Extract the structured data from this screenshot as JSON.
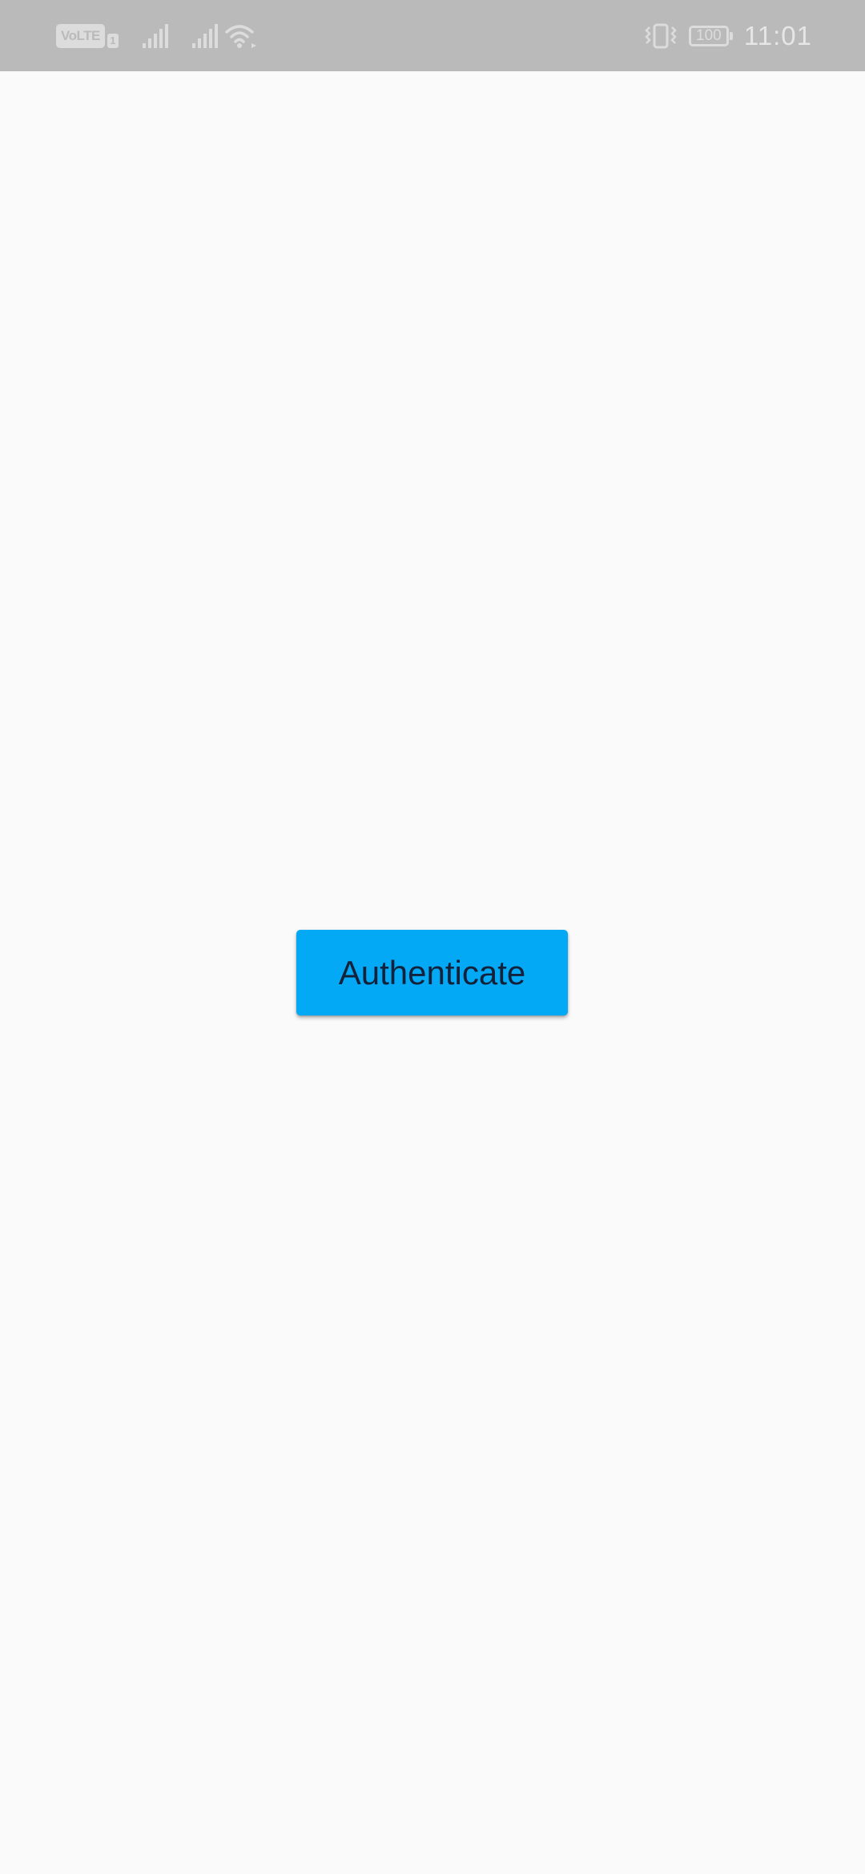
{
  "status_bar": {
    "network_badge": "VoLTE",
    "sim_slot": "1",
    "battery_level": "100",
    "time": "11:01",
    "icons": [
      "volte-icon",
      "signal-icon",
      "signal-icon",
      "wifi-icon",
      "vibrate-icon",
      "battery-icon"
    ]
  },
  "main": {
    "authenticate_label": "Authenticate"
  },
  "colors": {
    "status_bar_bg": "#bababa",
    "page_bg": "#fafafa",
    "button_bg": "#03a9f4",
    "button_text": "#14213a"
  }
}
